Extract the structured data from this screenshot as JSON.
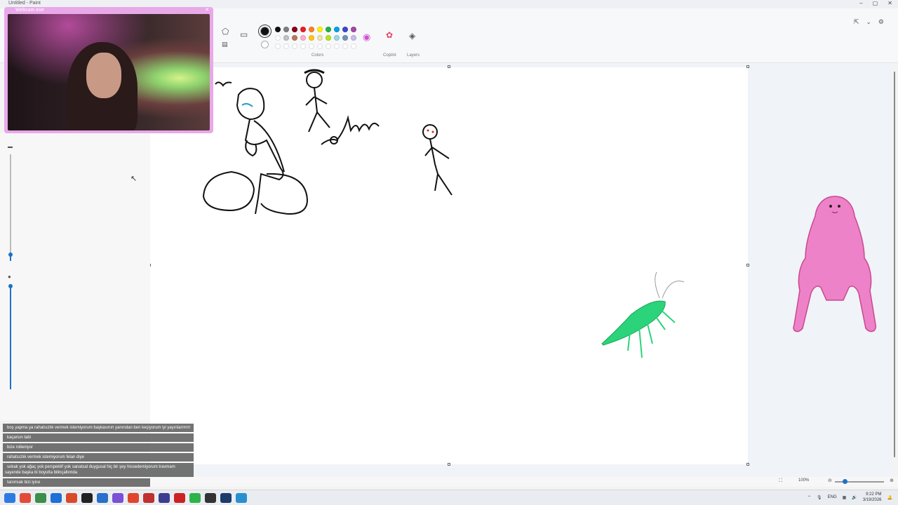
{
  "window": {
    "title": "Untitled - Paint"
  },
  "ribbon": {
    "colors_label": "Colors",
    "copilot_label": "Copilot",
    "layers_label": "Layers",
    "palette_row1": [
      "#111111",
      "#7f7f7f",
      "#880015",
      "#ed1c24",
      "#ff7f27",
      "#fff200",
      "#22b14c",
      "#00a2e8",
      "#3f48cc",
      "#a349a4"
    ],
    "palette_row2": [
      "#ffffff",
      "#c3c3c3",
      "#b97a57",
      "#ffaec9",
      "#ffc90e",
      "#efe4b0",
      "#b5e61d",
      "#99d9ea",
      "#7092be",
      "#c8bfe7"
    ],
    "palette_row3": [
      "#ffffff",
      "#ffffff",
      "#ffffff",
      "#ffffff",
      "#ffffff",
      "#ffffff",
      "#ffffff",
      "#ffffff",
      "#ffffff",
      "#ffffff"
    ]
  },
  "webcam": {
    "title": "Webcam.exe"
  },
  "chat": [
    {
      "user": "",
      "color": "#e0a030",
      "text": "boş yapma ya rahatsızlık vermek istemiyorum başkasının yanından ben keçiyorum iyi yayınlarrrrrrr"
    },
    {
      "user": "",
      "color": "#37c6a0",
      "text": "kaçarsın tabi"
    },
    {
      "user": "",
      "color": "#37c6a0",
      "text": "bize rolleniyor"
    },
    {
      "user": "",
      "color": "#37c6a0",
      "text": "rahatsızlık vermek istemiyorum felan diye"
    },
    {
      "user": "",
      "color": "#4f8ee8",
      "text": "sokak yok ağaç yok perspektif yok sanatsal duygusal hiç bir şey hissedemiyorum travmam sayende başka bi boyutta bilinçaltımda"
    },
    {
      "user": "",
      "color": "#37c6a0",
      "text": "tanımıak bizi iyice"
    }
  ],
  "status": {
    "zoom": "100%"
  },
  "taskbar": {
    "language": "ENG",
    "time": "9:22 PM",
    "date": "3/19/2026",
    "icon_colors": [
      "#2d7be0",
      "#e24b3a",
      "#3a8f4a",
      "#1e6fd6",
      "#d94a2a",
      "#222222",
      "#2a6fc9",
      "#7b4fd6",
      "#e0462c",
      "#c03030",
      "#3d3d8f",
      "#c22",
      "#2db34a",
      "#333333",
      "#1b3b6b",
      "#2a8fd0"
    ]
  }
}
